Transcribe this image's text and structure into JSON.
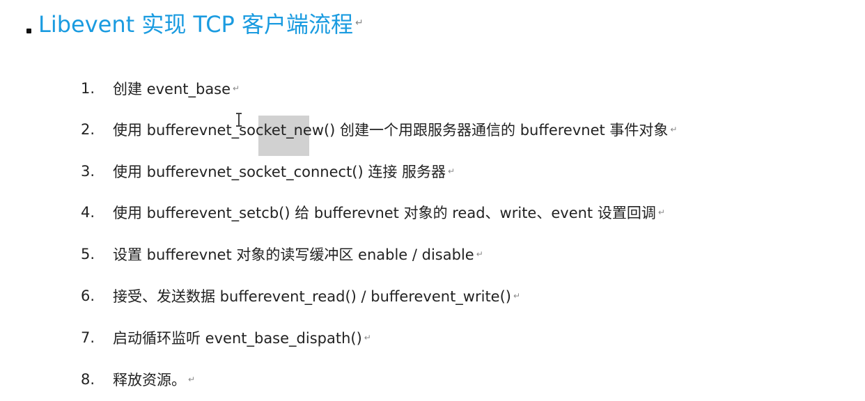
{
  "title": {
    "text": "Libevent 实现 TCP 客户端流程",
    "mark": "↵"
  },
  "steps": [
    {
      "num": "1.",
      "text": "创建  event_base",
      "mark": "↵"
    },
    {
      "num": "2.",
      "text": "使用  bufferevnet_socket_new() 创建一个用跟服务器通信的  bufferevnet  事件对象",
      "mark": "↵"
    },
    {
      "num": "3.",
      "text": "使用  bufferevnet_socket_connect() 连接  服务器",
      "mark": "↵"
    },
    {
      "num": "4.",
      "text": "使用  bufferevent_setcb() 给  bufferevnet 对象的  read、write、event  设置回调",
      "mark": "↵"
    },
    {
      "num": "5.",
      "text": "设置  bufferevnet 对象的读写缓冲区  enable / disable",
      "mark": "↵"
    },
    {
      "num": "6.",
      "text": "接受、发送数据  bufferevent_read() / bufferevent_write()  ",
      "mark": "↵"
    },
    {
      "num": "7.",
      "text": "启动循环监听  event_base_dispath()  ",
      "mark": "↵"
    },
    {
      "num": "8.",
      "text": "释放资源。",
      "mark": "↵"
    }
  ],
  "colors": {
    "title": "#1a9be0",
    "body_text": "#222222",
    "selection_highlight": "#c9c9c9"
  },
  "icons": {
    "cursor": "text-cursor-icon",
    "paragraph_mark": "paragraph-mark-icon"
  }
}
